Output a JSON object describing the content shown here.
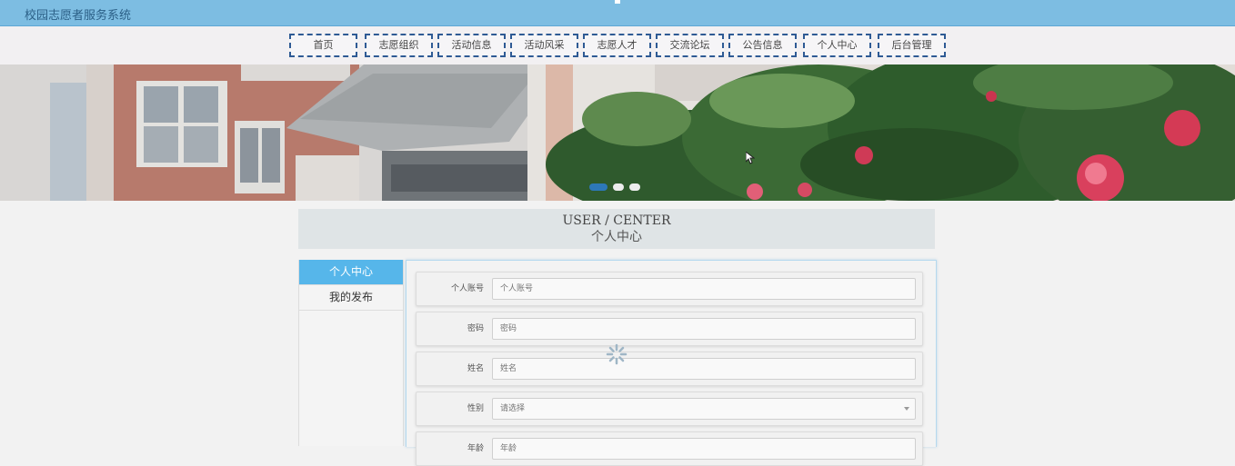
{
  "app": {
    "title": "校园志愿者服务系统"
  },
  "nav": {
    "items": [
      {
        "label": "首页"
      },
      {
        "label": "志愿组织"
      },
      {
        "label": "活动信息"
      },
      {
        "label": "活动风采"
      },
      {
        "label": "志愿人才"
      },
      {
        "label": "交流论坛"
      },
      {
        "label": "公告信息"
      },
      {
        "label": "个人中心"
      },
      {
        "label": "后台管理"
      }
    ]
  },
  "banner": {
    "slide_count": 3,
    "active_slide": 1
  },
  "center": {
    "heading_en": "USER / CENTER",
    "heading_zh": "个人中心"
  },
  "sidebar": {
    "items": [
      {
        "label": "个人中心",
        "active": true
      },
      {
        "label": "我的发布",
        "active": false
      }
    ]
  },
  "form": {
    "fields": [
      {
        "label": "个人账号",
        "placeholder": "个人账号"
      },
      {
        "label": "密码",
        "placeholder": "密码"
      },
      {
        "label": "姓名",
        "placeholder": "姓名"
      },
      {
        "label": "性别",
        "placeholder": "请选择"
      },
      {
        "label": "年龄",
        "placeholder": "年龄"
      }
    ]
  },
  "colors": {
    "topbar": "#7dbde2",
    "nav_border": "#2e5a94",
    "sidebar_active": "#56b6ea",
    "panel_border": "#b5d9ef"
  }
}
